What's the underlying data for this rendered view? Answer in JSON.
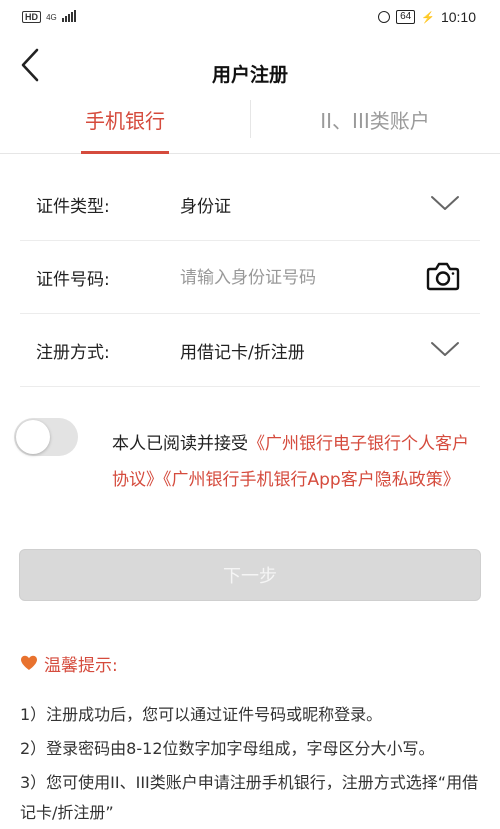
{
  "status_bar": {
    "hd": "HD",
    "network": "4G",
    "battery": "64",
    "time": "10:10"
  },
  "nav": {
    "title": "用户注册"
  },
  "tabs": [
    {
      "label": "手机银行",
      "active": true
    },
    {
      "label": "II、III类账户",
      "active": false
    }
  ],
  "form": {
    "id_type": {
      "label": "证件类型:",
      "value": "身份证"
    },
    "id_number": {
      "label": "证件号码:",
      "placeholder": "请输入身份证号码"
    },
    "register_method": {
      "label": "注册方式:",
      "value": "用借记卡/折注册"
    }
  },
  "agreement": {
    "toggle_on": false,
    "prefix": "本人已阅读并接受",
    "link1": "《广州银行电子银行个人客户协议》",
    "link2": "《广州银行手机银行App客户隐私政策》"
  },
  "next_button": "下一步",
  "tips": {
    "title": "温馨提示:",
    "items": [
      "1）注册成功后，您可以通过证件号码或昵称登录。",
      "2）登录密码由8-12位数字加字母组成，字母区分大小写。",
      "3）您可使用II、III类账户申请注册手机银行，注册方式选择“用借记卡/折注册”"
    ]
  },
  "colors": {
    "accent": "#d54b3d",
    "button_disabled": "#d9d9d9"
  }
}
